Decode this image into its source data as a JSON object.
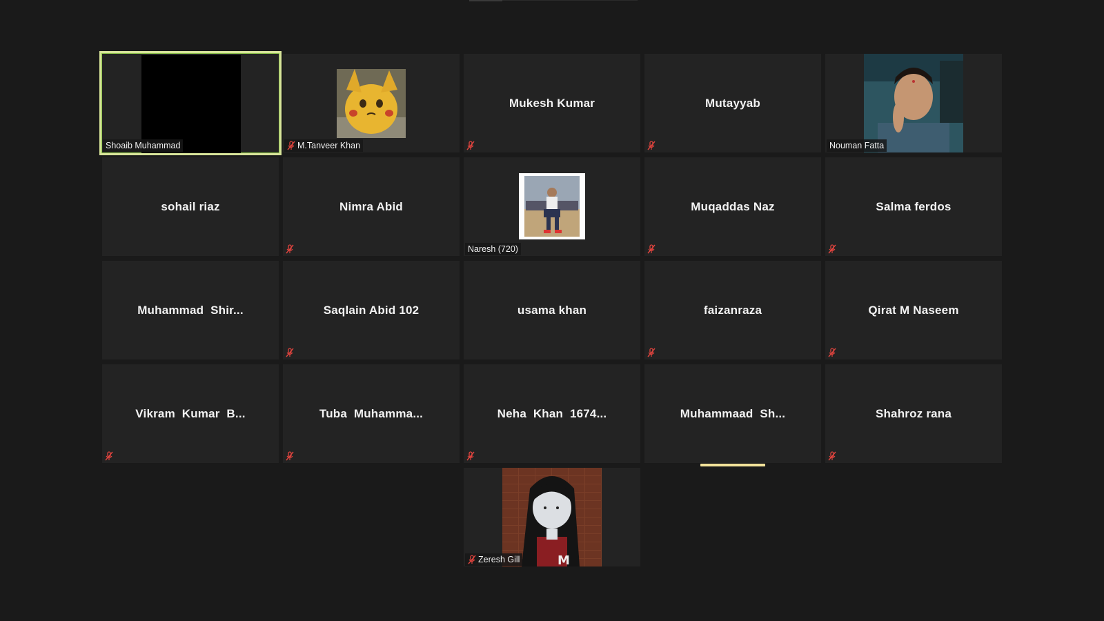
{
  "meeting": {
    "accent_color": "#d8e59a",
    "muted_icon_color": "#e0443e",
    "participants": [
      {
        "name": "Shoaib Muhammad",
        "display": "label",
        "muted": false,
        "active": true,
        "media": "black-video"
      },
      {
        "name": "M.Tanveer Khan",
        "display": "label",
        "muted": true,
        "media": "avatar-yellow-creature"
      },
      {
        "name": "Mukesh Kumar",
        "display": "center",
        "muted": true
      },
      {
        "name": "Mutayyab",
        "display": "center",
        "muted": true
      },
      {
        "name": "Nouman Fatta",
        "display": "label",
        "muted": false,
        "media": "video-man"
      },
      {
        "name": "sohail riaz",
        "display": "center",
        "muted": false
      },
      {
        "name": "Nimra Abid",
        "display": "center",
        "muted": true
      },
      {
        "name": "Naresh (720)",
        "display": "label",
        "muted": false,
        "media": "photo-man-sitting"
      },
      {
        "name": "Muqaddas Naz",
        "display": "center",
        "muted": true
      },
      {
        "name": "Salma ferdos",
        "display": "center",
        "muted": true
      },
      {
        "name": "Muhammad  Shir...",
        "display": "center",
        "muted": false
      },
      {
        "name": "Saqlain Abid 102",
        "display": "center",
        "muted": true
      },
      {
        "name": "usama khan",
        "display": "center",
        "muted": false
      },
      {
        "name": "faizanraza",
        "display": "center",
        "muted": true
      },
      {
        "name": "Qirat M Naseem",
        "display": "center",
        "muted": true
      },
      {
        "name": "Vikram  Kumar  B...",
        "display": "center",
        "muted": true
      },
      {
        "name": "Tuba  Muhamma...",
        "display": "center",
        "muted": true
      },
      {
        "name": "Neha  Khan  1674...",
        "display": "center",
        "muted": true
      },
      {
        "name": "Muhammaad  Sh...",
        "display": "center",
        "muted": false,
        "speaking": true
      },
      {
        "name": "Shahroz rana",
        "display": "center",
        "muted": true
      },
      {
        "name": "Zeresh Gill",
        "display": "label",
        "muted": true,
        "media": "avatar-cartoon-girl"
      }
    ]
  }
}
